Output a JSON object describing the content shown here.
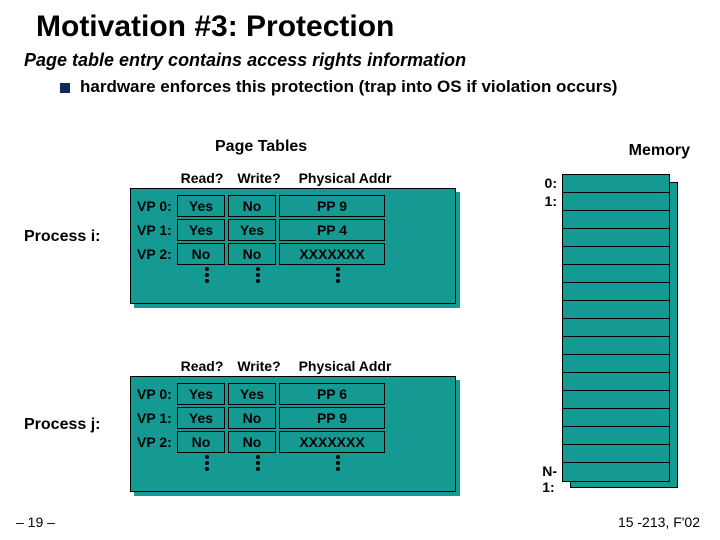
{
  "title": "Motivation #3: Protection",
  "subtitle": "Page table entry contains access rights information",
  "bullet": "hardware enforces this protection (trap into OS if violation occurs)",
  "labels": {
    "page_tables": "Page Tables",
    "memory": "Memory",
    "process_i": "Process i:",
    "process_j": "Process j:"
  },
  "headers": {
    "read": "Read?",
    "write": "Write?",
    "phys": "Physical Addr"
  },
  "table_i": [
    {
      "vp": "VP 0:",
      "read": "Yes",
      "write": "No",
      "phys": "PP 9"
    },
    {
      "vp": "VP 1:",
      "read": "Yes",
      "write": "Yes",
      "phys": "PP 4"
    },
    {
      "vp": "VP 2:",
      "read": "No",
      "write": "No",
      "phys": "XXXXXXX"
    }
  ],
  "table_j": [
    {
      "vp": "VP 0:",
      "read": "Yes",
      "write": "Yes",
      "phys": "PP 6"
    },
    {
      "vp": "VP 1:",
      "read": "Yes",
      "write": "No",
      "phys": "PP 9"
    },
    {
      "vp": "VP 2:",
      "read": "No",
      "write": "No",
      "phys": "XXXXXXX"
    }
  ],
  "memory_indices": {
    "first": "0:",
    "second": "1:",
    "last": "N-1:"
  },
  "footer": {
    "left": "– 19 –",
    "right": "15 -213, F'02"
  }
}
